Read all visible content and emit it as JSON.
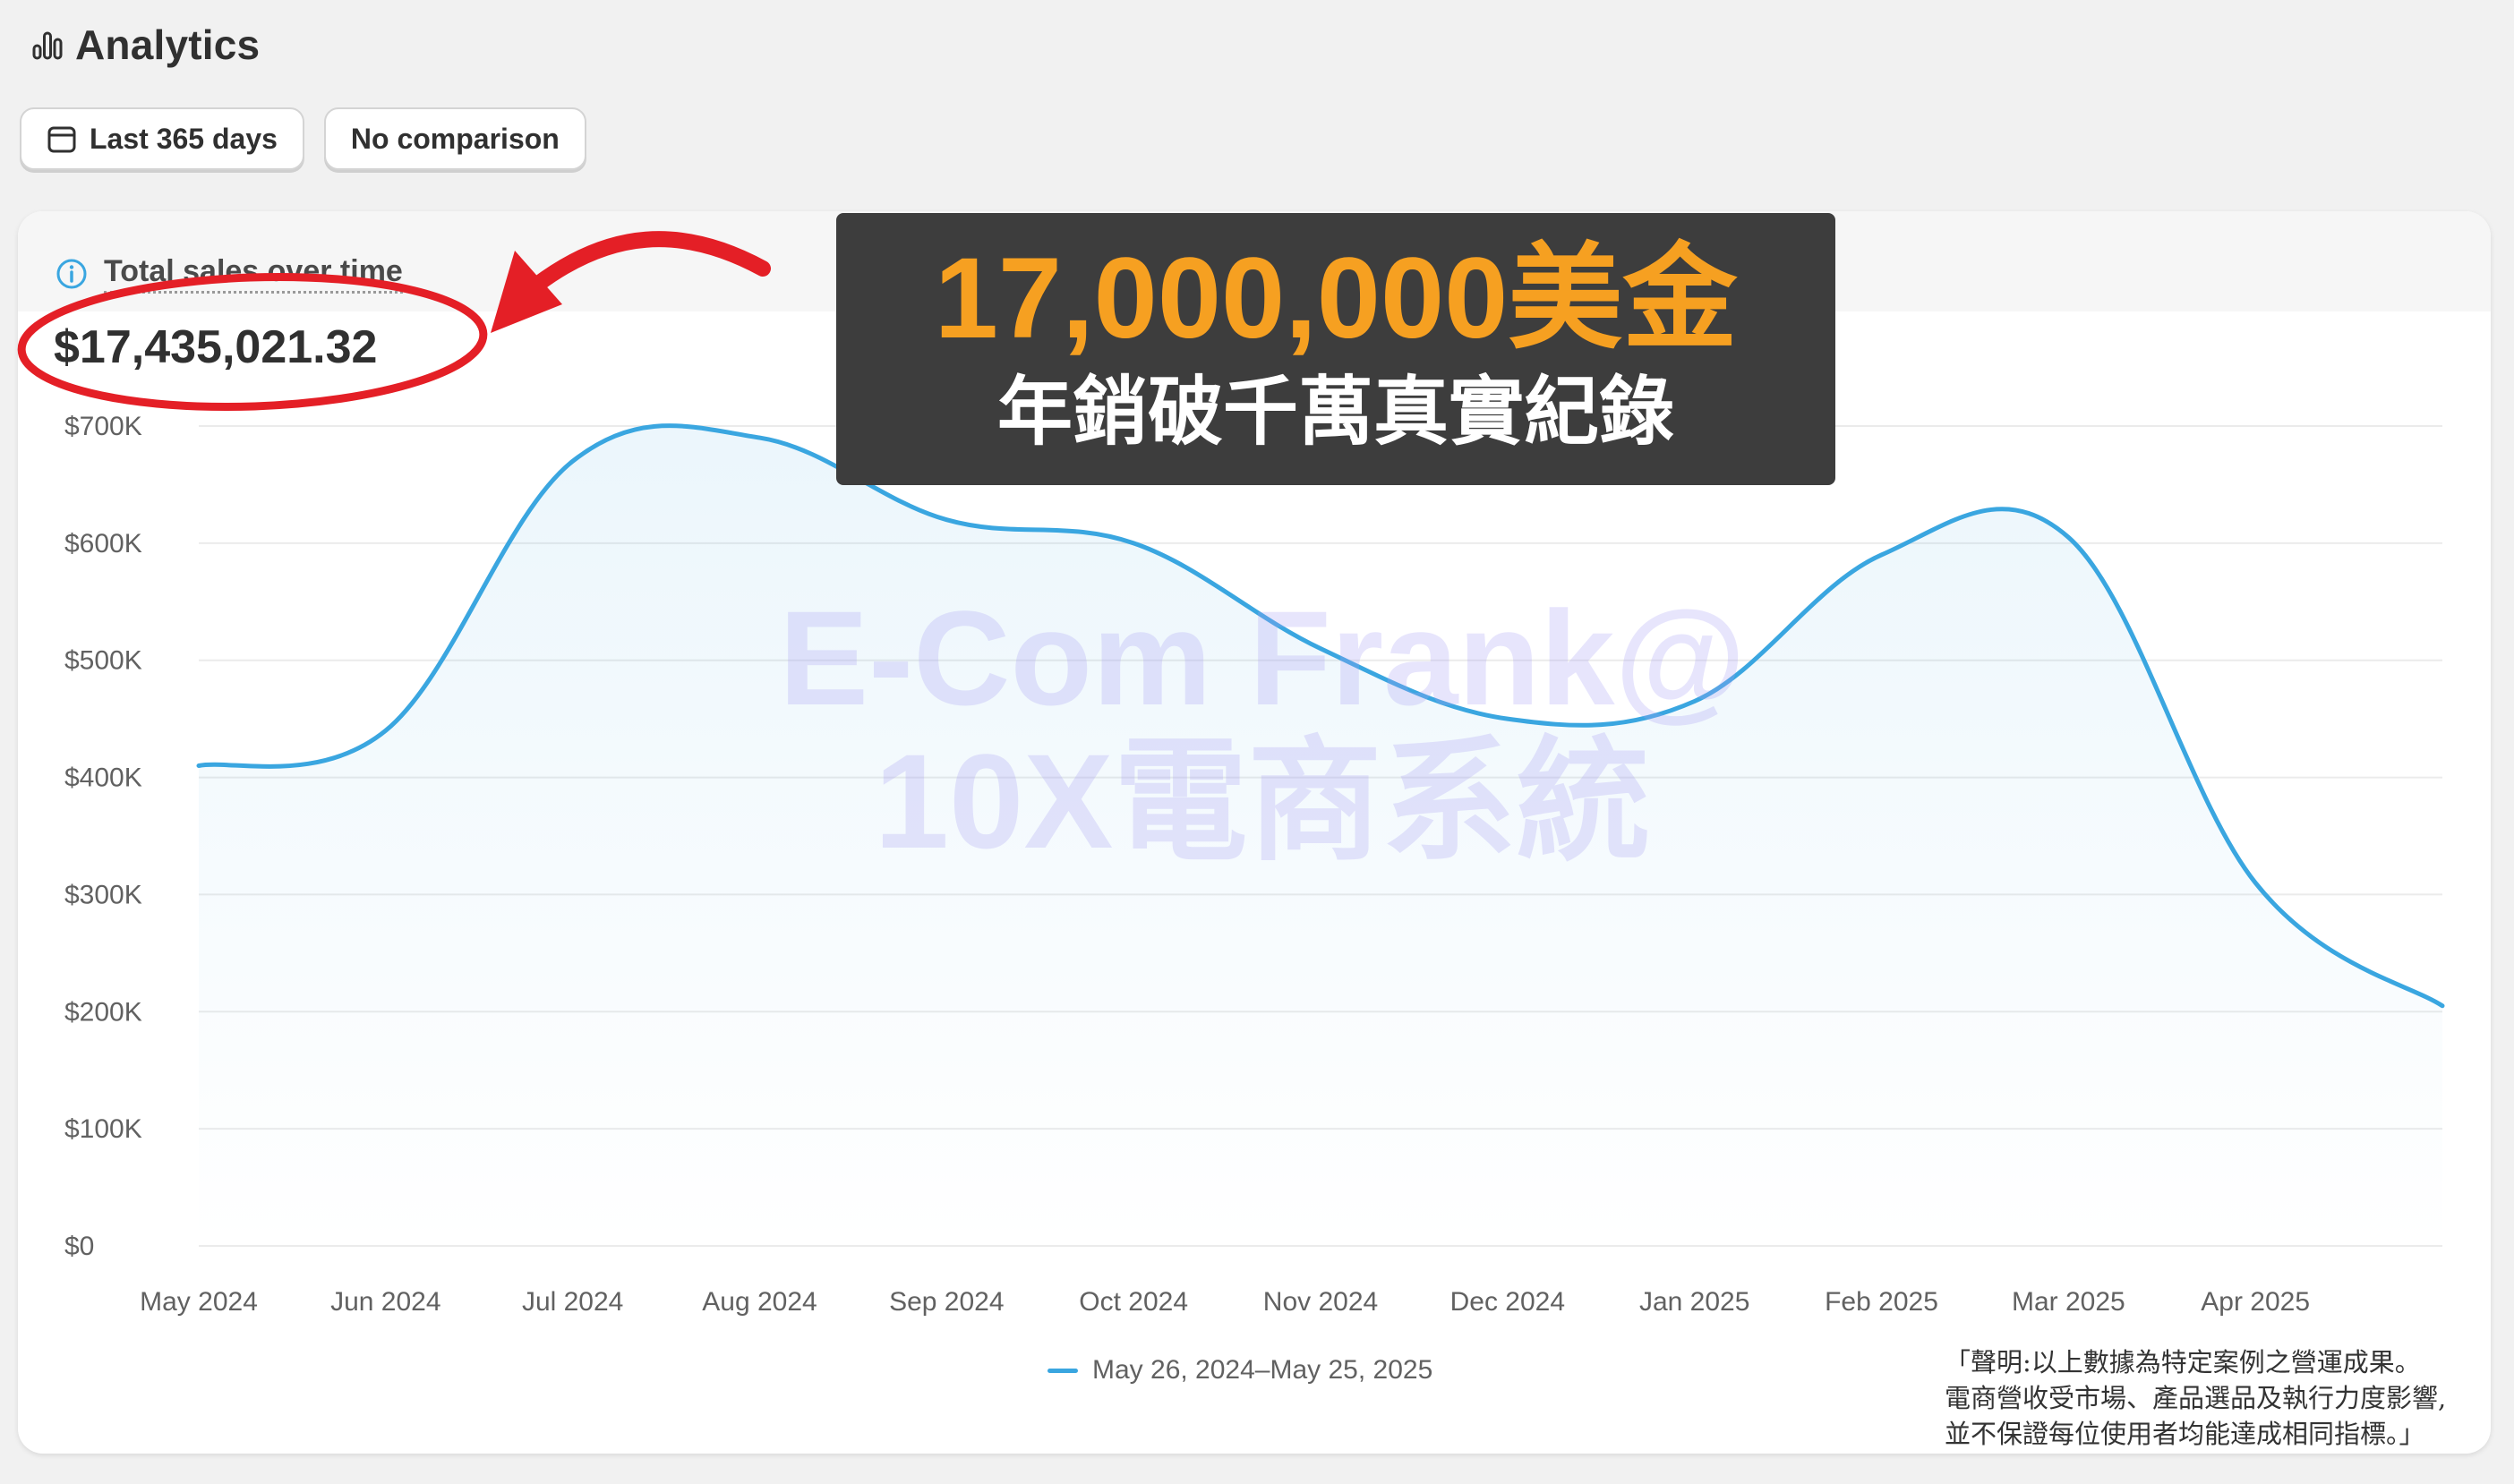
{
  "header": {
    "title": "Analytics",
    "icon": "bar-chart-icon"
  },
  "filters": {
    "date_range": {
      "label": "Last 365 days",
      "icon": "calendar-icon"
    },
    "comparison": {
      "label": "No comparison"
    }
  },
  "card": {
    "title": "Total sales over time",
    "info_icon": "info-icon",
    "total_value": "$17,435,021.32"
  },
  "chart_data": {
    "type": "area",
    "title": "Total sales over time",
    "xlabel": "",
    "ylabel": "",
    "ylim": [
      0,
      700000
    ],
    "yticks": [
      "$0",
      "$100K",
      "$200K",
      "$300K",
      "$400K",
      "$500K",
      "$600K",
      "$700K"
    ],
    "categories": [
      "May 2024",
      "Jun 2024",
      "Jul 2024",
      "Aug 2024",
      "Sep 2024",
      "Oct 2024",
      "Nov 2024",
      "Dec 2024",
      "Jan 2025",
      "Feb 2025",
      "Mar 2025",
      "Apr 2025"
    ],
    "x": [
      0,
      1,
      2,
      3,
      4,
      5,
      6,
      7,
      8,
      9,
      10,
      11,
      12
    ],
    "series": [
      {
        "name": "May 26, 2024–May 25, 2025",
        "color": "#3aa6e0",
        "values": [
          410000,
          440000,
          670000,
          690000,
          620000,
          600000,
          510000,
          450000,
          465000,
          590000,
          605000,
          310000,
          205000
        ]
      }
    ],
    "grid": true,
    "legend": "bottom-center"
  },
  "watermark": {
    "line1": "E-Com Frank@",
    "line2": "10X電商系統"
  },
  "banner": {
    "headline": "17,000,000美金",
    "subline": "年銷破千萬真實紀錄",
    "headline_color": "#f6a021"
  },
  "disclaimer": {
    "line1": "「聲明:以上數據為特定案例之營運成果。",
    "line2": "電商營收受市場、產品選品及執行力度影響,",
    "line3": "並不保證每位使用者均能達成相同指標。」"
  },
  "colors": {
    "page_bg": "#f1f1f1",
    "line": "#3aa6e0",
    "annotation": "#e41f26"
  }
}
